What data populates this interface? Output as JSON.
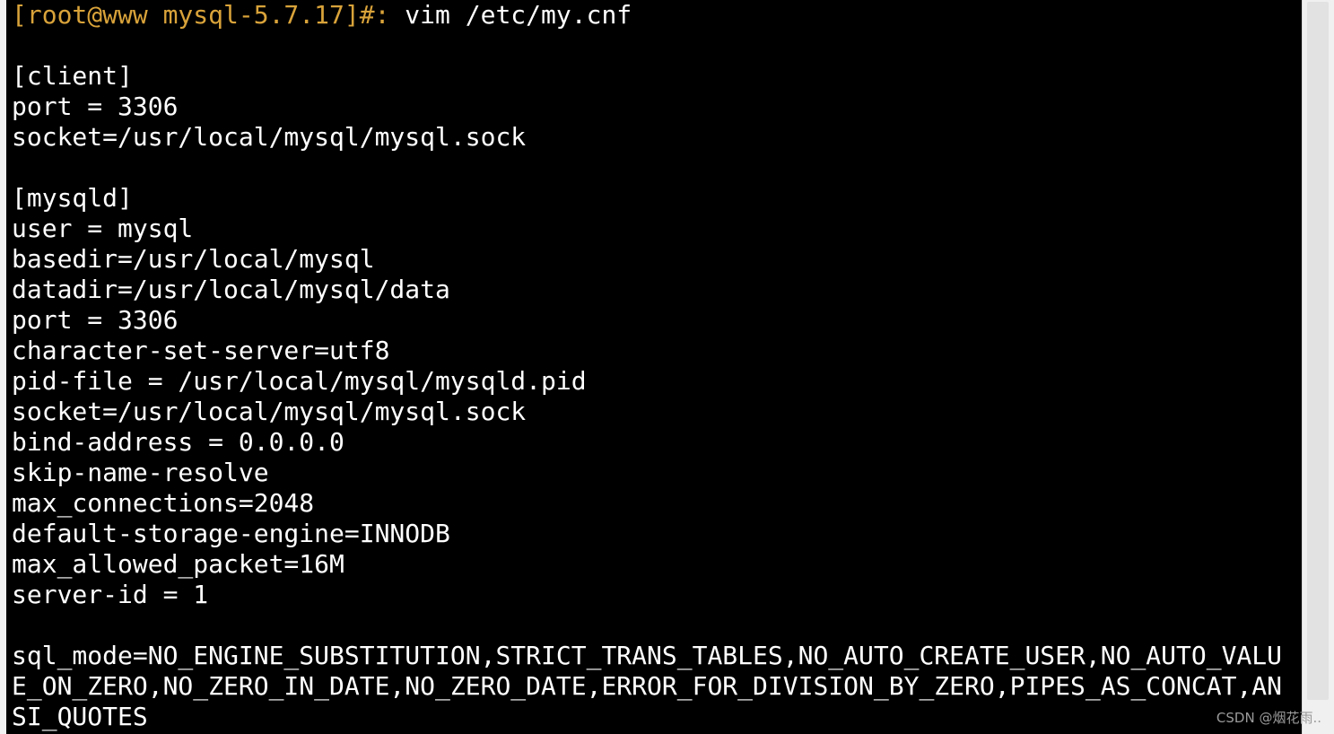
{
  "terminal": {
    "prompt": "[root@www mysql-5.7.17]#:",
    "command": " vim /etc/my.cnf",
    "lines": [
      "",
      "[client]",
      "port = 3306",
      "socket=/usr/local/mysql/mysql.sock",
      "",
      "[mysqld]",
      "user = mysql",
      "basedir=/usr/local/mysql",
      "datadir=/usr/local/mysql/data",
      "port = 3306",
      "character-set-server=utf8",
      "pid-file = /usr/local/mysql/mysqld.pid",
      "socket=/usr/local/mysql/mysql.sock",
      "bind-address = 0.0.0.0",
      "skip-name-resolve",
      "max_connections=2048",
      "default-storage-engine=INNODB",
      "max_allowed_packet=16M",
      "server-id = 1",
      "",
      "sql_mode=NO_ENGINE_SUBSTITUTION,STRICT_TRANS_TABLES,NO_AUTO_CREATE_USER,NO_AUTO_VALU",
      "E_ON_ZERO,NO_ZERO_IN_DATE,NO_ZERO_DATE,ERROR_FOR_DIVISION_BY_ZERO,PIPES_AS_CONCAT,AN",
      "SI_QUOTES"
    ]
  },
  "watermark": "CSDN @烟花雨..",
  "colors": {
    "background": "#000000",
    "text": "#ffffff",
    "prompt": "#d9a33a"
  }
}
